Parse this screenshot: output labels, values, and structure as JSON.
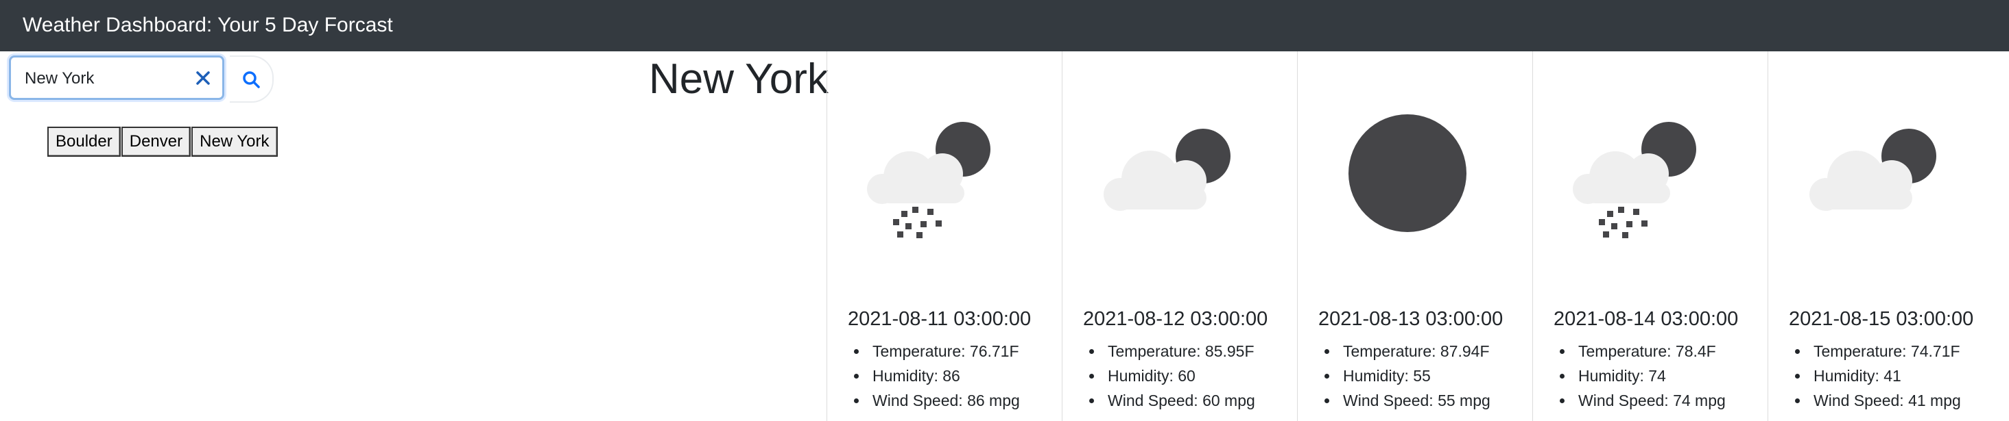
{
  "header": {
    "title": "Weather Dashboard: Your 5 Day Forcast"
  },
  "search": {
    "value": "New York"
  },
  "history": [
    "Boulder",
    "Denver",
    "New York"
  ],
  "current": {
    "city": "New York"
  },
  "forecast": [
    {
      "date": "2021-08-11 03:00:00",
      "icon": "cloud-moon-snow-icon",
      "temperature": "Temperature: 76.71F",
      "humidity": "Humidity: 86",
      "wind": "Wind Speed: 86 mpg"
    },
    {
      "date": "2021-08-12 03:00:00",
      "icon": "cloud-moon-icon",
      "temperature": "Temperature: 85.95F",
      "humidity": "Humidity: 60",
      "wind": "Wind Speed: 60 mpg"
    },
    {
      "date": "2021-08-13 03:00:00",
      "icon": "full-moon-icon",
      "temperature": "Temperature: 87.94F",
      "humidity": "Humidity: 55",
      "wind": "Wind Speed: 55 mpg"
    },
    {
      "date": "2021-08-14 03:00:00",
      "icon": "cloud-moon-snow-icon",
      "temperature": "Temperature: 78.4F",
      "humidity": "Humidity: 74",
      "wind": "Wind Speed: 74 mpg"
    },
    {
      "date": "2021-08-15 03:00:00",
      "icon": "cloud-moon-icon",
      "temperature": "Temperature: 74.71F",
      "humidity": "Humidity: 41",
      "wind": "Wind Speed: 41 mpg"
    }
  ],
  "colors": {
    "navbar": "#343a40",
    "icon_dark": "#454548",
    "cloud": "#efefef",
    "accent": "#0d6efd"
  }
}
